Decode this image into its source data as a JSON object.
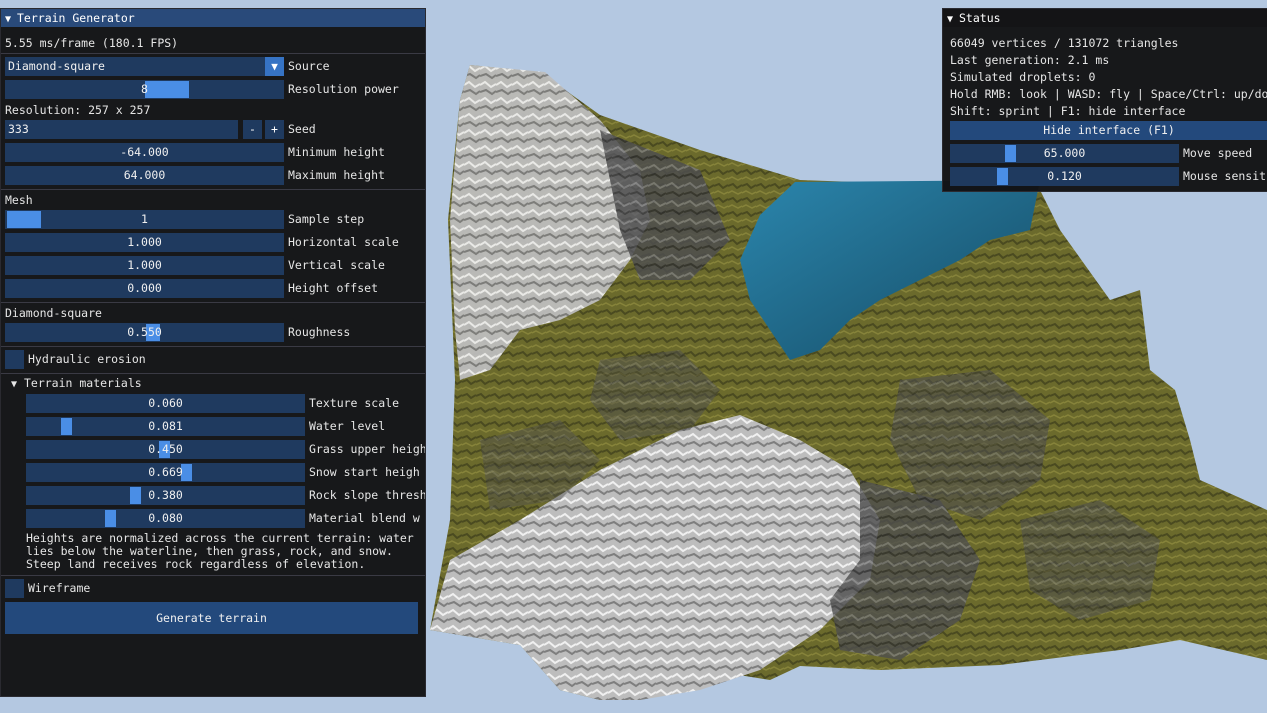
{
  "colors": {
    "sky": "#b4c8e1",
    "title_bar": "#294a7a",
    "frame": "#1f3a5f",
    "slider_grab": "#4a8ee6",
    "button": "#23497c",
    "water": "#1d6384",
    "grass": "#6b6a2c",
    "rock": "#5c5c5c",
    "snow": "#cfcfcf"
  },
  "generator": {
    "title": "Terrain Generator",
    "frametime": "5.55 ms/frame (180.1 FPS)",
    "source": {
      "value": "Diamond-square",
      "label": "Source"
    },
    "resolution_power": {
      "value": "8",
      "label": "Resolution power",
      "fraction": 0.5
    },
    "resolution_text": "Resolution: 257 x 257",
    "seed": {
      "value": "333",
      "label": "Seed",
      "minus": "-",
      "plus": "+"
    },
    "min_height": {
      "value": "-64.000",
      "label": "Minimum height"
    },
    "max_height": {
      "value": "64.000",
      "label": "Maximum height"
    },
    "mesh_header": "Mesh",
    "sample_step": {
      "value": "1",
      "label": "Sample step",
      "fraction": 0.0
    },
    "horizontal_scale": {
      "value": "1.000",
      "label": "Horizontal scale"
    },
    "vertical_scale": {
      "value": "1.000",
      "label": "Vertical scale"
    },
    "height_offset": {
      "value": "0.000",
      "label": "Height offset"
    },
    "ds_header": "Diamond-square",
    "roughness": {
      "value": "0.550",
      "label": "Roughness",
      "fraction": 0.55
    },
    "hydraulic": {
      "label": "Hydraulic erosion",
      "checked": false
    },
    "materials_header": "Terrain materials",
    "texture_scale": {
      "value": "0.060",
      "label": "Texture scale"
    },
    "water_level": {
      "value": "0.081",
      "label": "Water level",
      "fraction": 0.081
    },
    "grass_upper": {
      "value": "0.450",
      "label": "Grass upper heigh",
      "fraction": 0.45
    },
    "snow_start": {
      "value": "0.669",
      "label": "Snow start heigh",
      "fraction": 0.669
    },
    "rock_slope": {
      "value": "0.380",
      "label": "Rock slope thresh",
      "fraction": 0.38
    },
    "blend": {
      "value": "0.080",
      "label": "Material blend w",
      "fraction": 0.08
    },
    "note": "Heights are normalized across the current terrain: water lies below the waterline, then grass, rock, and snow. Steep land receives rock regardless of elevation.",
    "wireframe": {
      "label": "Wireframe",
      "checked": false
    },
    "generate": "Generate terrain"
  },
  "status": {
    "title": "Status",
    "counts": "66049 vertices / 131072 triangles",
    "last_gen": "Last generation: 2.1 ms",
    "droplets": "Simulated droplets: 0",
    "controls1": "Hold RMB: look | WASD: fly | Space/Ctrl: up/do",
    "controls2": "Shift: sprint | F1: hide interface",
    "hide_button": "Hide interface (F1)",
    "move_speed": {
      "value": "65.000",
      "label": "Move speed",
      "fraction": 0.26
    },
    "mouse_sens": {
      "value": "0.120",
      "label": "Mouse sensit",
      "fraction": 0.2
    }
  }
}
